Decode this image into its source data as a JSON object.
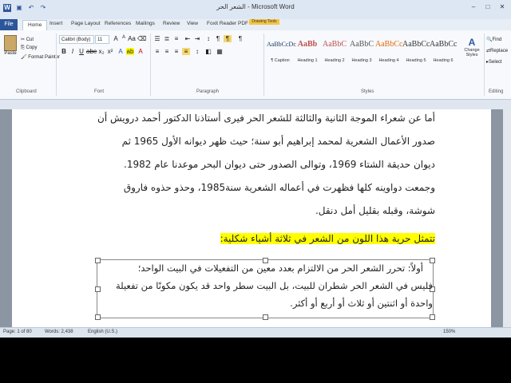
{
  "window": {
    "title": "الشعر الحر - Microsoft Word",
    "qat_icons": [
      "word-icon",
      "save-icon",
      "undo-icon",
      "redo-icon"
    ],
    "controls": [
      "–",
      "□",
      "✕"
    ]
  },
  "tabs": [
    {
      "label": "File"
    },
    {
      "label": "Home"
    },
    {
      "label": "Insert"
    },
    {
      "label": "Page Layout"
    },
    {
      "label": "References"
    },
    {
      "label": "Mailings"
    },
    {
      "label": "Review"
    },
    {
      "label": "View"
    },
    {
      "label": "Foxit Reader PDF"
    },
    {
      "label": "Format"
    }
  ],
  "context_tab": "Drawing Tools",
  "clipboard": {
    "paste": "Paste",
    "cut": "Cut",
    "copy": "Copy",
    "format_painter": "Format Painter",
    "group": "Clipboard"
  },
  "font": {
    "name": "Calibri (Body)",
    "size": "11",
    "group": "Font"
  },
  "paragraph": {
    "group": "Paragraph"
  },
  "styles": {
    "items": [
      {
        "sample": "AaBbCcDc",
        "name": "¶ Caption"
      },
      {
        "sample": "AaBb",
        "name": "Heading 1"
      },
      {
        "sample": "AaBbC",
        "name": "Heading 2"
      },
      {
        "sample": "AaBbC",
        "name": "Heading 3"
      },
      {
        "sample": "AaBbCc",
        "name": "Heading 4"
      },
      {
        "sample": "AaBbCc",
        "name": "Heading 5"
      },
      {
        "sample": "AaBbCc",
        "name": "Heading 6"
      }
    ],
    "change_styles": "Change Styles",
    "group": "Styles"
  },
  "editing": {
    "find": "Find",
    "replace": "Replace",
    "select": "Select",
    "group": "Editing"
  },
  "document": {
    "lines": [
      "أما عن شعراء الموجة الثانية والثالثة للشعر الحر فيرى أستاذنا الدكتور أحمد درويش أن",
      "صدور الأعمال الشعرية لمحمد إبراهيم أبو سنة؛ حيث ظهر ديوانه الأول 1965 ثم",
      "ديوان حديقة الشتاء 1969، وتوالى الصدور حتى ديوان البحر موعدنا عام 1982.",
      "وجمعت دواوينه كلها فظهرت في أعماله الشعرية سنة1985، وحذو حذوه فاروق",
      "شوشة، وقبله بقليل أمل دنقل."
    ],
    "highlight": "تتمثل حرية هذا اللون من الشعر في ثلاثة أشياء شكلية:",
    "textbox_lines": [
      "أولاً: تحرر الشعر الحر من الالتزام بعدد معين من التفعيلات في البيت الواحد؛",
      "فليس في الشعر الحر شطران للبيت، بل البيت سطر واحد قد يكون مكونًا من تفعيلة",
      "واحدة أو اثنتين أو ثلاث أو أربع أو أكثر."
    ]
  },
  "status": {
    "page": "Page: 1 of 80",
    "words": "Words: 2,438",
    "language": "English (U.S.)",
    "zoom": "150%"
  }
}
